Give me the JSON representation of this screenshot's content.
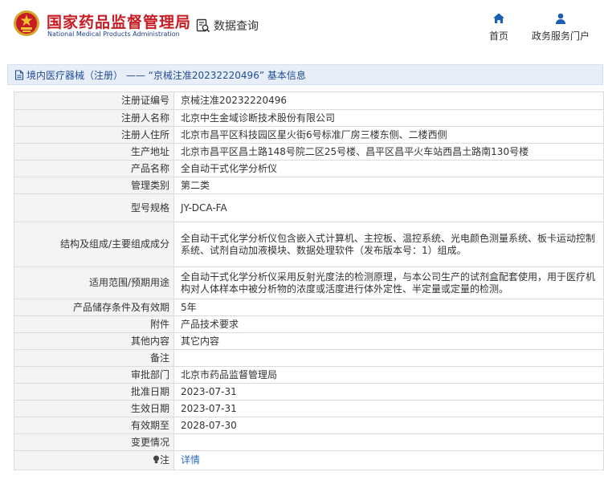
{
  "header": {
    "brand_cn": "国家药品监督管理局",
    "brand_en": "National Medical Products Administration",
    "logo_icon": "emblem-logo-icon",
    "query_label": "数据查询",
    "nav": [
      {
        "label": "首页",
        "icon": "home-icon"
      },
      {
        "label": "政务服务门户",
        "icon": "user-icon"
      }
    ]
  },
  "title_bar": {
    "text": "境内医疗器械（注册） —— “京械注准20232220496” 基本信息"
  },
  "detail": {
    "rows": [
      {
        "label": "注册证编号",
        "value": "京械注准20232220496"
      },
      {
        "label": "注册人名称",
        "value": "北京中生金域诊断技术股份有限公司"
      },
      {
        "label": "注册人住所",
        "value": "北京市昌平区科技园区星火街6号标准厂房三楼东侧、二楼西侧"
      },
      {
        "label": "生产地址",
        "value": "北京市昌平区昌土路148号院二区25号楼、昌平区昌平火车站西昌土路南130号楼"
      },
      {
        "label": "产品名称",
        "value": "全自动干式化学分析仪"
      },
      {
        "label": "管理类别",
        "value": "第二类"
      },
      {
        "label": "型号规格",
        "value": "JY-DCA-FA"
      },
      {
        "label": "结构及组成/主要组成成分",
        "value": "全自动干式化学分析仪包含嵌入式计算机、主控板、温控系统、光电颜色测量系统、板卡运动控制系统、试剂自动加液模块、数据处理软件（发布版本号：1）组成。"
      },
      {
        "label": "适用范围/预期用途",
        "value": "全自动干式化学分析仪采用反射光度法的检测原理，与本公司生产的试剂盒配套使用，用于医疗机构对人体样本中被分析物的浓度或活度进行体外定性、半定量或定量的检测。"
      },
      {
        "label": "产品储存条件及有效期",
        "value": "5年"
      },
      {
        "label": "附件",
        "value": "产品技术要求"
      },
      {
        "label": "其他内容",
        "value": "其它内容"
      },
      {
        "label": "备注",
        "value": ""
      },
      {
        "label": "审批部门",
        "value": "北京市药品监督管理局"
      },
      {
        "label": "批准日期",
        "value": "2023-07-31"
      },
      {
        "label": "生效日期",
        "value": "2023-07-31"
      },
      {
        "label": "有效期至",
        "value": "2028-07-30"
      },
      {
        "label": "变更情况",
        "value": ""
      },
      {
        "label": "注",
        "value": "详情"
      }
    ]
  },
  "colors": {
    "brand_red": "#c81c24",
    "brand_blue": "#1d3f8a",
    "title_blue": "#1f4d96",
    "link_blue": "#2a6ebb",
    "nav_icon_blue": "#1a5fb4"
  }
}
